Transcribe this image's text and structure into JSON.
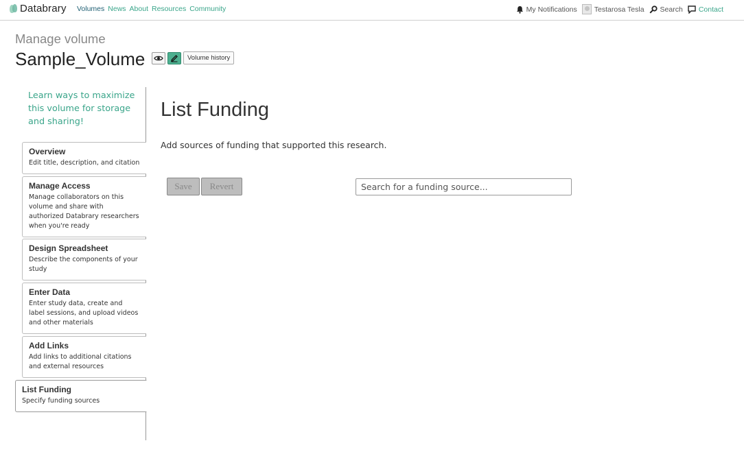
{
  "nav": {
    "logo": "Databrary",
    "links": [
      "Volumes",
      "News",
      "About",
      "Resources",
      "Community"
    ],
    "active_link": "Volumes",
    "notifications": "My Notifications",
    "user": "Testarosa Tesla",
    "search": "Search",
    "contact": "Contact"
  },
  "header": {
    "label": "Manage volume",
    "volume_name": "Sample_Volume",
    "history_button": "Volume history"
  },
  "sidebar": {
    "learn_link": "Learn ways to maximize this volume for storage and sharing!",
    "steps": [
      {
        "title": "Overview",
        "desc": "Edit title, description, and citation"
      },
      {
        "title": "Manage Access",
        "desc": "Manage collaborators on this volume and share with authorized Databrary researchers when you're ready"
      },
      {
        "title": "Design Spreadsheet",
        "desc": "Describe the components of your study"
      },
      {
        "title": "Enter Data",
        "desc": "Enter study data, create and label sessions, and upload videos and other materials"
      },
      {
        "title": "Add Links",
        "desc": "Add links to additional citations and external resources"
      },
      {
        "title": "List Funding",
        "desc": "Specify funding sources"
      }
    ],
    "active_step": "List Funding"
  },
  "main": {
    "title": "List Funding",
    "description": "Add sources of funding that supported this research.",
    "save_label": "Save",
    "revert_label": "Revert",
    "search_placeholder": "Search for a funding source...",
    "search_value": ""
  },
  "colors": {
    "accent": "#3aa58a",
    "active_nav": "#1f5f73",
    "edit_button": "#4caf8f",
    "disabled_button": "#bdbdbd"
  },
  "icons": [
    "bell-icon",
    "avatar",
    "search-icon",
    "chat-icon",
    "eye-icon",
    "pencil-icon"
  ]
}
